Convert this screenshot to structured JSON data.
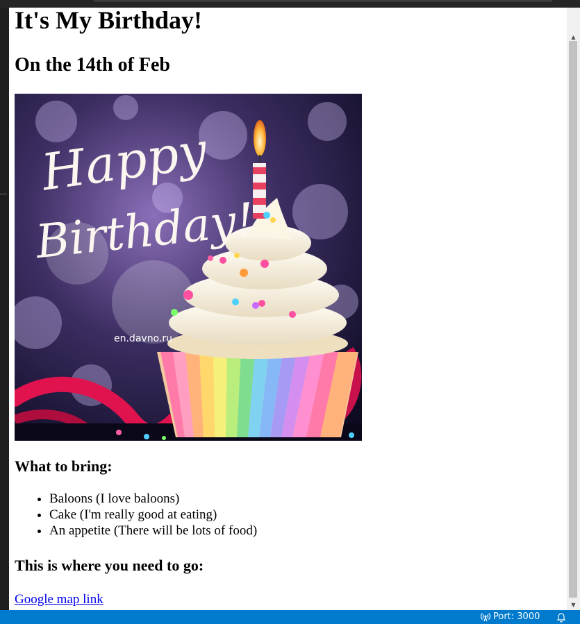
{
  "page": {
    "heading": "It's My Birthday!",
    "date_heading": "On the 14th of Feb",
    "image": {
      "greeting_line1": "Happy",
      "greeting_line2": "Birthday!",
      "watermark": "en.davno.ru"
    },
    "bring_heading": "What to bring:",
    "bring_items": [
      "Baloons (I love baloons)",
      "Cake (I'm really good at eating)",
      "An appetite (There will be lots of food)"
    ],
    "where_heading": "This is where you need to go:",
    "map_link_text": "Google map link"
  },
  "statusbar": {
    "port_label": "Port: 3000",
    "port_icon": "broadcast-icon",
    "bell_icon": "bell-icon"
  },
  "colors": {
    "statusbar_bg": "#007acc",
    "link": "#0000ee"
  }
}
